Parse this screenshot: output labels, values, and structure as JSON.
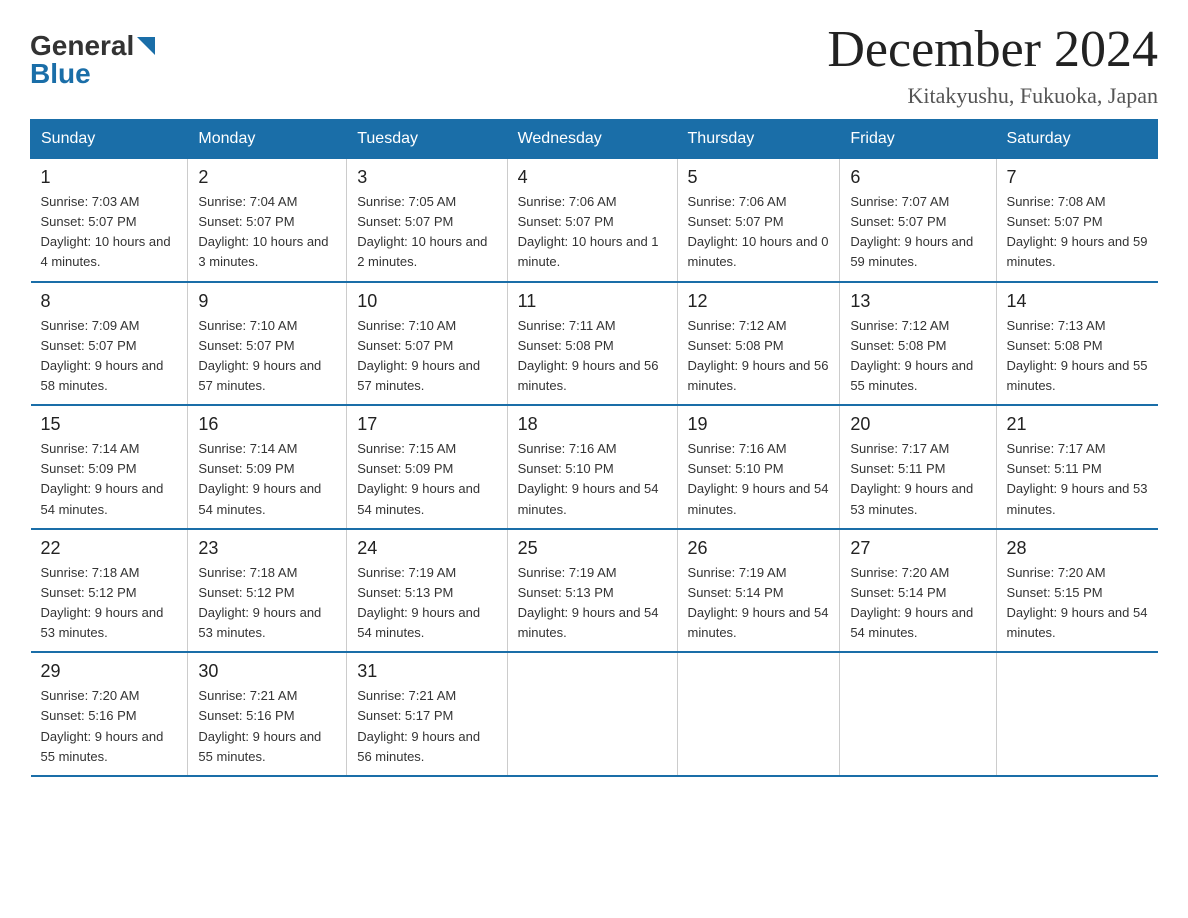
{
  "header": {
    "logo_general": "General",
    "logo_blue": "Blue",
    "title": "December 2024",
    "subtitle": "Kitakyushu, Fukuoka, Japan"
  },
  "days_of_week": [
    "Sunday",
    "Monday",
    "Tuesday",
    "Wednesday",
    "Thursday",
    "Friday",
    "Saturday"
  ],
  "weeks": [
    [
      {
        "day": "1",
        "sunrise": "7:03 AM",
        "sunset": "5:07 PM",
        "daylight": "10 hours and 4 minutes."
      },
      {
        "day": "2",
        "sunrise": "7:04 AM",
        "sunset": "5:07 PM",
        "daylight": "10 hours and 3 minutes."
      },
      {
        "day": "3",
        "sunrise": "7:05 AM",
        "sunset": "5:07 PM",
        "daylight": "10 hours and 2 minutes."
      },
      {
        "day": "4",
        "sunrise": "7:06 AM",
        "sunset": "5:07 PM",
        "daylight": "10 hours and 1 minute."
      },
      {
        "day": "5",
        "sunrise": "7:06 AM",
        "sunset": "5:07 PM",
        "daylight": "10 hours and 0 minutes."
      },
      {
        "day": "6",
        "sunrise": "7:07 AM",
        "sunset": "5:07 PM",
        "daylight": "9 hours and 59 minutes."
      },
      {
        "day": "7",
        "sunrise": "7:08 AM",
        "sunset": "5:07 PM",
        "daylight": "9 hours and 59 minutes."
      }
    ],
    [
      {
        "day": "8",
        "sunrise": "7:09 AM",
        "sunset": "5:07 PM",
        "daylight": "9 hours and 58 minutes."
      },
      {
        "day": "9",
        "sunrise": "7:10 AM",
        "sunset": "5:07 PM",
        "daylight": "9 hours and 57 minutes."
      },
      {
        "day": "10",
        "sunrise": "7:10 AM",
        "sunset": "5:07 PM",
        "daylight": "9 hours and 57 minutes."
      },
      {
        "day": "11",
        "sunrise": "7:11 AM",
        "sunset": "5:08 PM",
        "daylight": "9 hours and 56 minutes."
      },
      {
        "day": "12",
        "sunrise": "7:12 AM",
        "sunset": "5:08 PM",
        "daylight": "9 hours and 56 minutes."
      },
      {
        "day": "13",
        "sunrise": "7:12 AM",
        "sunset": "5:08 PM",
        "daylight": "9 hours and 55 minutes."
      },
      {
        "day": "14",
        "sunrise": "7:13 AM",
        "sunset": "5:08 PM",
        "daylight": "9 hours and 55 minutes."
      }
    ],
    [
      {
        "day": "15",
        "sunrise": "7:14 AM",
        "sunset": "5:09 PM",
        "daylight": "9 hours and 54 minutes."
      },
      {
        "day": "16",
        "sunrise": "7:14 AM",
        "sunset": "5:09 PM",
        "daylight": "9 hours and 54 minutes."
      },
      {
        "day": "17",
        "sunrise": "7:15 AM",
        "sunset": "5:09 PM",
        "daylight": "9 hours and 54 minutes."
      },
      {
        "day": "18",
        "sunrise": "7:16 AM",
        "sunset": "5:10 PM",
        "daylight": "9 hours and 54 minutes."
      },
      {
        "day": "19",
        "sunrise": "7:16 AM",
        "sunset": "5:10 PM",
        "daylight": "9 hours and 54 minutes."
      },
      {
        "day": "20",
        "sunrise": "7:17 AM",
        "sunset": "5:11 PM",
        "daylight": "9 hours and 53 minutes."
      },
      {
        "day": "21",
        "sunrise": "7:17 AM",
        "sunset": "5:11 PM",
        "daylight": "9 hours and 53 minutes."
      }
    ],
    [
      {
        "day": "22",
        "sunrise": "7:18 AM",
        "sunset": "5:12 PM",
        "daylight": "9 hours and 53 minutes."
      },
      {
        "day": "23",
        "sunrise": "7:18 AM",
        "sunset": "5:12 PM",
        "daylight": "9 hours and 53 minutes."
      },
      {
        "day": "24",
        "sunrise": "7:19 AM",
        "sunset": "5:13 PM",
        "daylight": "9 hours and 54 minutes."
      },
      {
        "day": "25",
        "sunrise": "7:19 AM",
        "sunset": "5:13 PM",
        "daylight": "9 hours and 54 minutes."
      },
      {
        "day": "26",
        "sunrise": "7:19 AM",
        "sunset": "5:14 PM",
        "daylight": "9 hours and 54 minutes."
      },
      {
        "day": "27",
        "sunrise": "7:20 AM",
        "sunset": "5:14 PM",
        "daylight": "9 hours and 54 minutes."
      },
      {
        "day": "28",
        "sunrise": "7:20 AM",
        "sunset": "5:15 PM",
        "daylight": "9 hours and 54 minutes."
      }
    ],
    [
      {
        "day": "29",
        "sunrise": "7:20 AM",
        "sunset": "5:16 PM",
        "daylight": "9 hours and 55 minutes."
      },
      {
        "day": "30",
        "sunrise": "7:21 AM",
        "sunset": "5:16 PM",
        "daylight": "9 hours and 55 minutes."
      },
      {
        "day": "31",
        "sunrise": "7:21 AM",
        "sunset": "5:17 PM",
        "daylight": "9 hours and 56 minutes."
      },
      null,
      null,
      null,
      null
    ]
  ]
}
